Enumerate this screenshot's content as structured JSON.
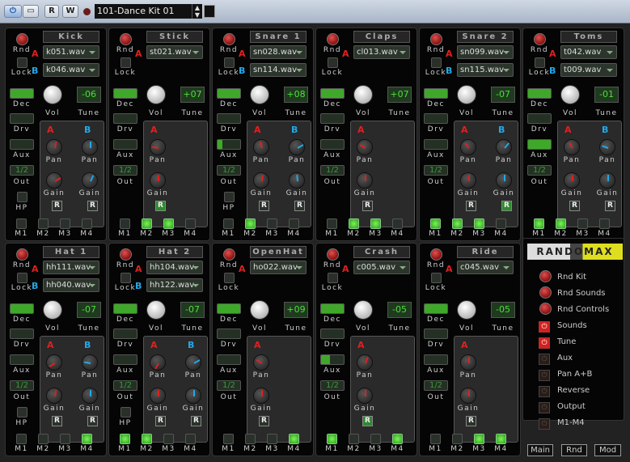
{
  "toolbar": {
    "power_label": "⏻",
    "window_label": "▭",
    "read_label": "R",
    "write_label": "W",
    "preset": "101-Dance Kit 01",
    "save_icon": "save-icon"
  },
  "common": {
    "rnd": "Rnd",
    "lock": "Lock",
    "a": "A",
    "b": "B",
    "dec": "Dec",
    "vol": "Vol",
    "tune": "Tune",
    "drv": "Drv",
    "aux": "Aux",
    "out": "Out",
    "hp": "HP",
    "pan": "Pan",
    "gain": "Gain",
    "r": "R",
    "m": [
      "M1",
      "M2",
      "M3",
      "M4"
    ]
  },
  "colors": {
    "a": "#e02020",
    "b": "#22a8e8",
    "led": "#4ede3a"
  },
  "modules": [
    {
      "name": "Kick",
      "a": "k051.wav",
      "b": "k046.wav",
      "tune": "-06",
      "out": "1/2",
      "dec": 1,
      "drv": 0,
      "aux": 0,
      "hp": true,
      "m": [
        0,
        0,
        0,
        0
      ],
      "panA": 10,
      "gainA": 60,
      "panB": 0,
      "gainB": 25,
      "rA": false,
      "rB": false
    },
    {
      "name": "Stick",
      "a": "st021.wav",
      "b": null,
      "tune": "+07",
      "out": "1/2",
      "dec": 1,
      "drv": 0,
      "aux": 0,
      "hp": false,
      "m": [
        0,
        1,
        1,
        0
      ],
      "panA": -80,
      "gainA": 0,
      "rA": true
    },
    {
      "name": "Snare 1",
      "a": "sn028.wav",
      "b": "sn114.wav",
      "tune": "+08",
      "out": "1/2",
      "dec": 1,
      "drv": 0,
      "aux": 0.2,
      "hp": true,
      "m": [
        0,
        1,
        0,
        0
      ],
      "panA": -15,
      "gainA": 5,
      "panB": 60,
      "gainB": -5,
      "rA": false,
      "rB": false
    },
    {
      "name": "Claps",
      "a": "cl013.wav",
      "b": null,
      "tune": "+07",
      "out": "1/2",
      "dec": 1,
      "drv": 0,
      "aux": 0,
      "hp": false,
      "m": [
        0,
        1,
        1,
        0
      ],
      "panA": -60,
      "gainA": 0,
      "rA": false
    },
    {
      "name": "Snare 2",
      "a": "sn099.wav",
      "b": "sn115.wav",
      "tune": "-07",
      "out": "1/2",
      "dec": 1,
      "drv": 0,
      "aux": 0,
      "hp": false,
      "m": [
        1,
        1,
        1,
        0
      ],
      "panA": -40,
      "gainA": 0,
      "panB": 40,
      "gainB": 0,
      "rA": false,
      "rB": true
    },
    {
      "name": "Toms",
      "a": "t042.wav",
      "b": "t009.wav",
      "tune": "-01",
      "out": "1/2",
      "dec": 1,
      "drv": 0,
      "aux": 1,
      "hp": false,
      "m": [
        1,
        1,
        0,
        0
      ],
      "panA": -30,
      "gainA": 0,
      "panB": -70,
      "gainB": 0,
      "rA": false,
      "rB": false
    },
    {
      "name": "Hat 1",
      "a": "hh111.wav",
      "b": "hh040.wav",
      "tune": "-07",
      "out": "1/2",
      "dec": 1,
      "drv": 0,
      "aux": 0,
      "hp": true,
      "m": [
        0,
        0,
        0,
        1
      ],
      "panA": -120,
      "gainA": 10,
      "panB": -80,
      "gainB": 0,
      "rA": false,
      "rB": false
    },
    {
      "name": "Hat 2",
      "a": "hh104.wav",
      "b": "hh122.wav",
      "tune": "-07",
      "out": "1/2",
      "dec": 1,
      "drv": 0,
      "aux": 0,
      "hp": false,
      "hp2": true,
      "m": [
        1,
        1,
        0,
        0
      ],
      "panA": -150,
      "gainA": 0,
      "panB": 60,
      "gainB": 0,
      "rA": false,
      "rB": false
    },
    {
      "name": "OpenHat",
      "a": "ho022.wav",
      "b": null,
      "tune": "+09",
      "out": "1/2",
      "dec": 1,
      "drv": 0,
      "aux": 0,
      "hp": false,
      "m": [
        0,
        0,
        0,
        1
      ],
      "panA": -60,
      "gainA": 0,
      "rA": false
    },
    {
      "name": "Crash",
      "a": "c005.wav",
      "b": null,
      "tune": "-05",
      "out": "1/2",
      "dec": 1,
      "drv": 0,
      "aux": 0.4,
      "hp": false,
      "m": [
        1,
        0,
        0,
        1
      ],
      "panA": 20,
      "gainA": 0,
      "rA": true
    },
    {
      "name": "Ride",
      "a": "c045.wav",
      "b": null,
      "tune": "-05",
      "out": "1/2",
      "dec": 1,
      "drv": 0,
      "aux": 0,
      "hp": false,
      "m": [
        0,
        0,
        1,
        1
      ],
      "panA": 0,
      "gainA": 0,
      "rA": false
    }
  ],
  "randomax": {
    "logo": "RANDOMAX",
    "buttons": [
      "Rnd Kit",
      "Rnd Sounds",
      "Rnd Controls"
    ],
    "toggles": [
      {
        "label": "Sounds",
        "on": true
      },
      {
        "label": "Tune",
        "on": true
      },
      {
        "label": "Aux",
        "on": false
      },
      {
        "label": "Pan A+B",
        "on": false
      },
      {
        "label": "Reverse",
        "on": false
      },
      {
        "label": "Output",
        "on": false
      },
      {
        "label": "M1-M4",
        "on": false
      }
    ],
    "tabs": [
      "Main",
      "Rnd",
      "Mod"
    ]
  }
}
